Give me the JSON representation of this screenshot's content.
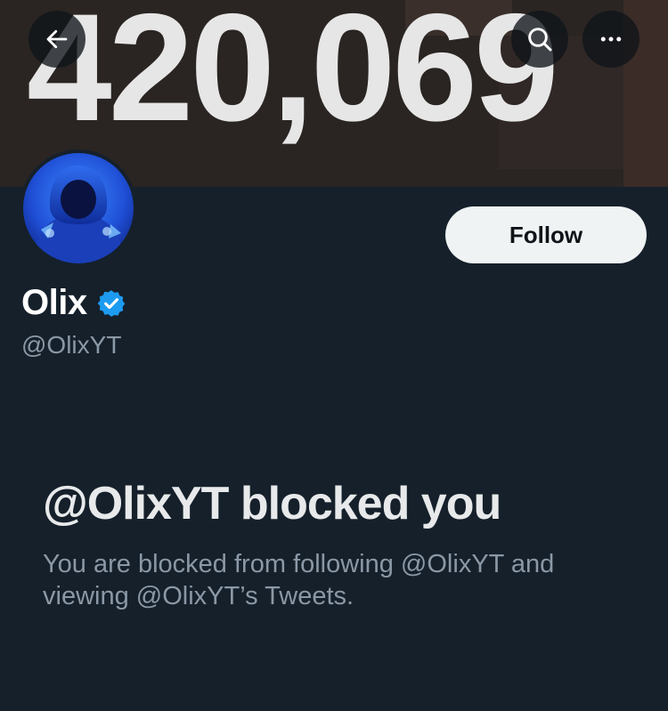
{
  "header": {
    "banner_text": "420,069",
    "back_icon": "arrow-left-icon",
    "search_icon": "search-icon",
    "more_icon": "more-horizontal-icon"
  },
  "profile": {
    "name": "Olix",
    "handle": "@OlixYT",
    "verified": true,
    "verified_color": "#1d9bf0",
    "follow_label": "Follow"
  },
  "blocked": {
    "title": "@OlixYT blocked you",
    "description": "You are blocked from following @OlixYT and viewing @OlixYT’s Tweets."
  },
  "colors": {
    "background": "#15202b",
    "text_primary": "#e7e9ea",
    "text_secondary": "#8b98a5",
    "button_bg": "#eff3f4"
  }
}
